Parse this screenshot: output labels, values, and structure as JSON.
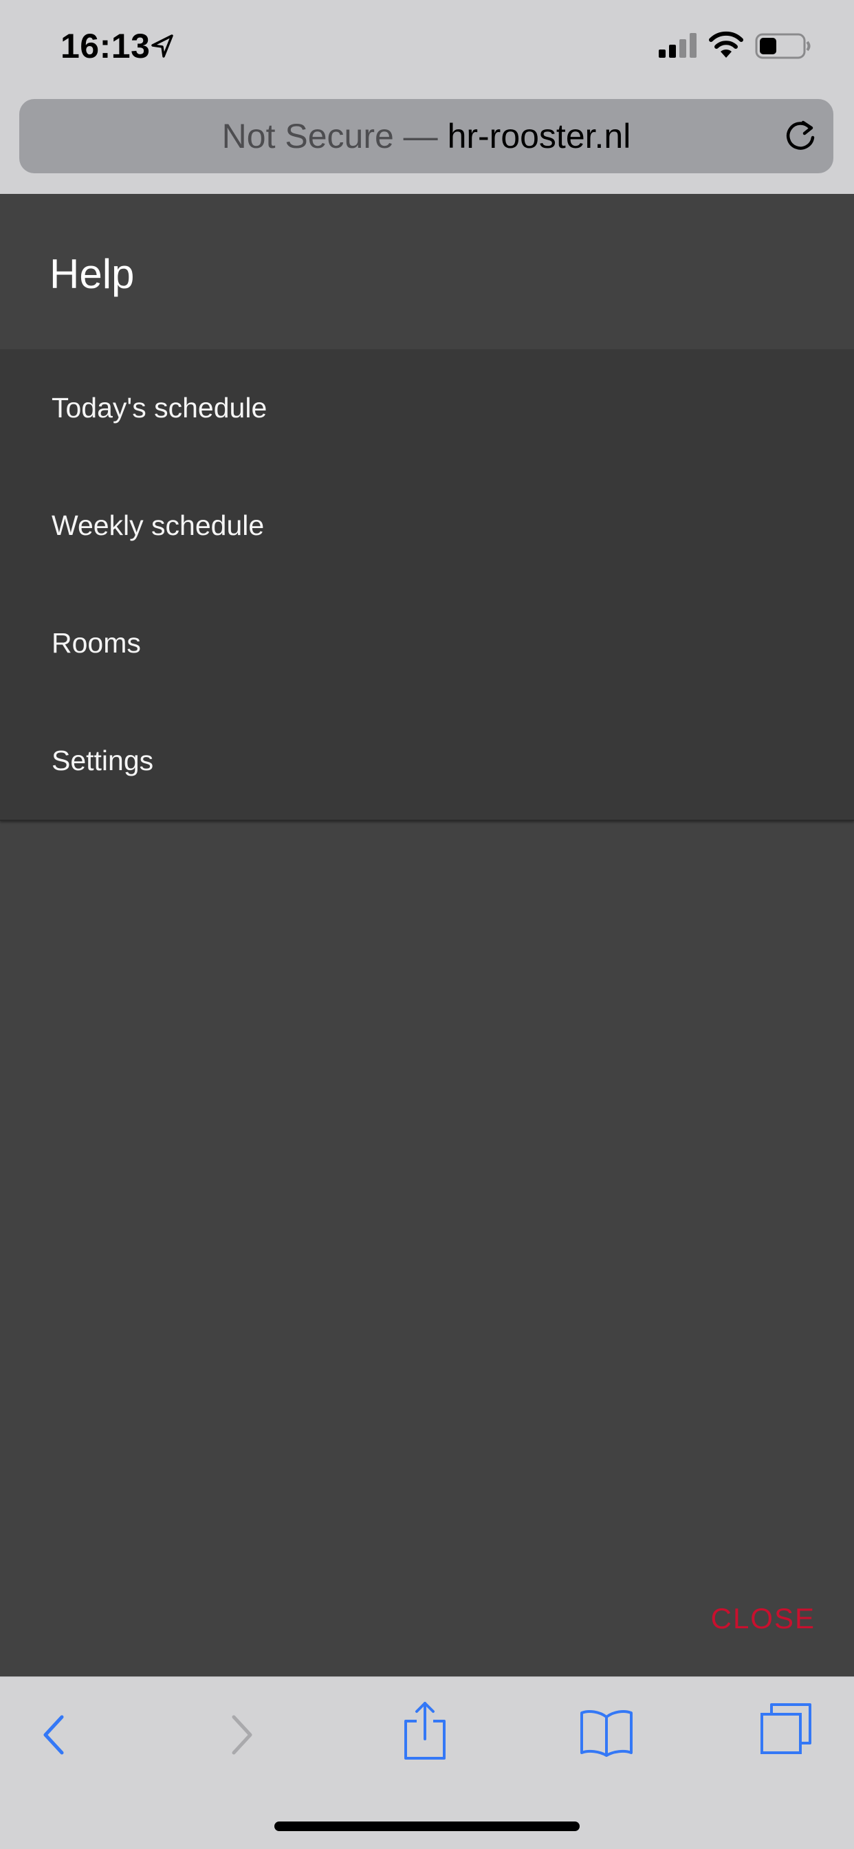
{
  "status_bar": {
    "time": "16:13",
    "location_icon": "location-arrow-icon",
    "signal_icon": "cellular-signal-icon",
    "wifi_icon": "wifi-icon",
    "battery_icon": "battery-icon",
    "battery_level": 0.4
  },
  "browser": {
    "url_prefix": "Not Secure — ",
    "url_domain": "hr-rooster.nl",
    "reload_icon": "reload-icon"
  },
  "help": {
    "title": "Help",
    "menu_items": [
      {
        "label": "Today's schedule"
      },
      {
        "label": "Weekly schedule"
      },
      {
        "label": "Rooms"
      },
      {
        "label": "Settings"
      }
    ],
    "close_label": "CLOSE"
  },
  "toolbar": {
    "icons": [
      "back-icon",
      "forward-icon",
      "share-icon",
      "bookmarks-icon",
      "tabs-icon"
    ]
  },
  "colors": {
    "accent_blue": "#3478f6",
    "close_red": "#c8102e",
    "panel_bg": "#424242",
    "menu_bg": "#393939"
  }
}
